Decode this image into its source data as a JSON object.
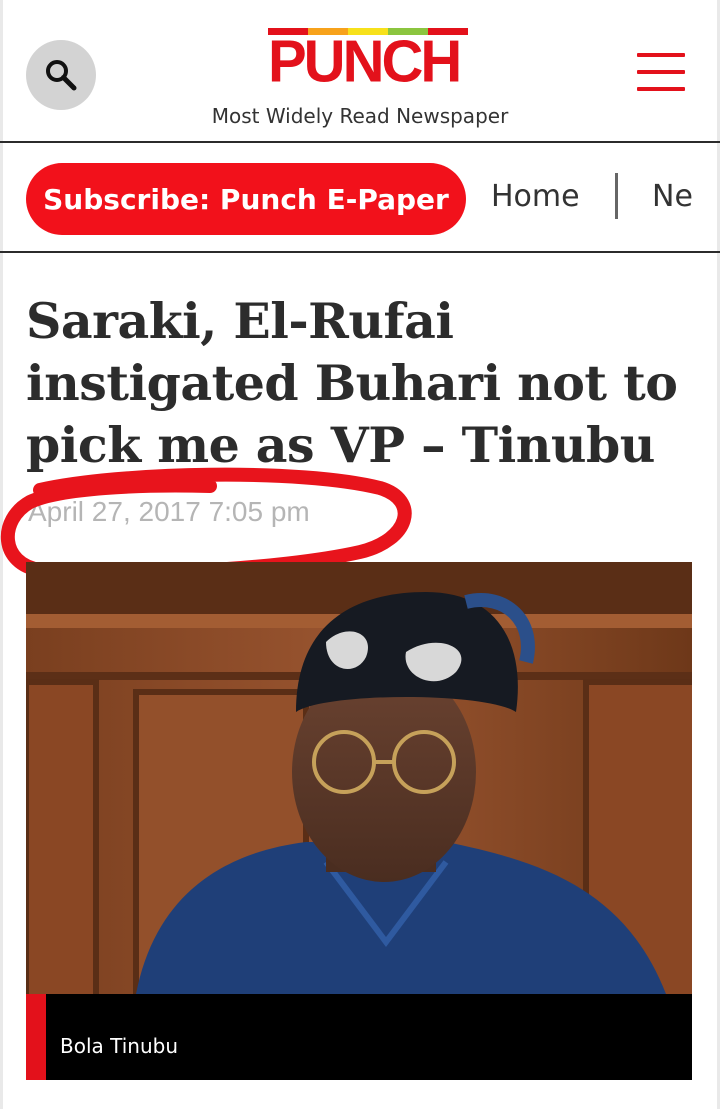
{
  "header": {
    "logo_text": "PUNCH",
    "tagline": "Most Widely Read Newspaper",
    "search_icon": "search-icon",
    "menu_icon": "hamburger-menu-icon"
  },
  "nav": {
    "subscribe_label": "Subscribe: Punch E-Paper",
    "items": [
      {
        "label": "Home"
      },
      {
        "label": "Ne"
      }
    ]
  },
  "article": {
    "headline": "Saraki, El-Rufai instigated Buhari not to pick me as VP – Tinubu",
    "date": "April 27, 2017 7:05 pm",
    "image_caption": "Bola Tinubu"
  },
  "colors": {
    "brand_red": "#e3111b",
    "subscribe_red": "#f2111b",
    "logo_bar_colors": [
      "#e3111b",
      "#f7a21b",
      "#f7e11b",
      "#8bc53f",
      "#e3111b"
    ]
  }
}
